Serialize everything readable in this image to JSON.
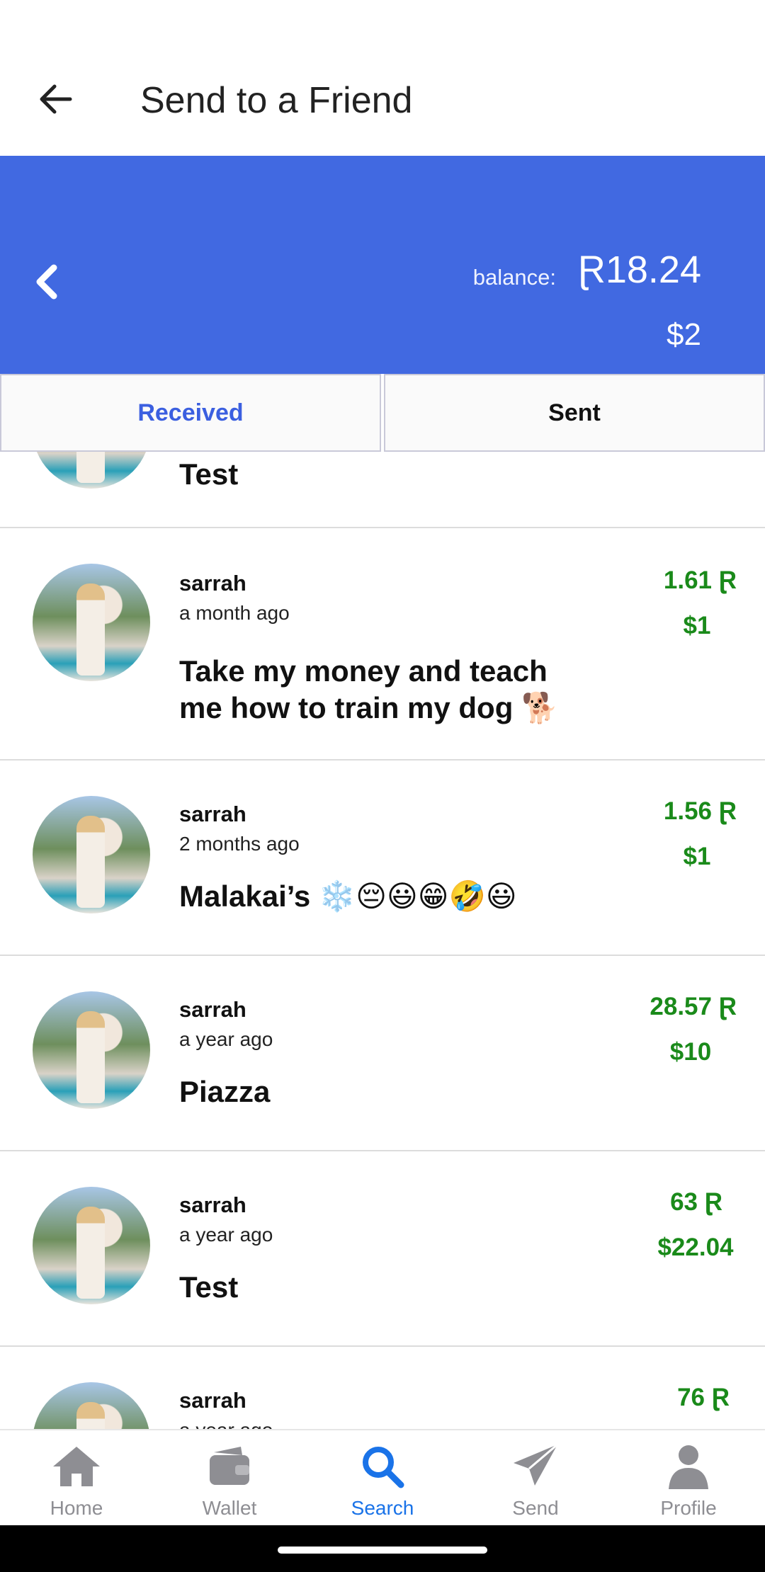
{
  "appbar": {
    "title": "Send to a Friend",
    "back_icon": "arrow-left-icon"
  },
  "balance": {
    "label": "balance:",
    "value": "Ɽ18.24",
    "usd": "$2"
  },
  "tabs": [
    {
      "label": "Received"
    },
    {
      "label": "Sent"
    }
  ],
  "transactions": [
    {
      "sender": "",
      "time": "",
      "message": "Test",
      "amount": "",
      "usd": ""
    },
    {
      "sender": "sarrah",
      "time": "a month ago",
      "message": "Take my money and teach me how to train my dog 🐕",
      "amount": "1.61 Ɽ",
      "usd": "$1"
    },
    {
      "sender": "sarrah",
      "time": "2 months ago",
      "message": "Malakai’s ❄️😔😃😁🤣😃",
      "amount": "1.56 Ɽ",
      "usd": "$1"
    },
    {
      "sender": "sarrah",
      "time": "a year ago",
      "message": "Piazza",
      "amount": "28.57 Ɽ",
      "usd": "$10"
    },
    {
      "sender": "sarrah",
      "time": "a year ago",
      "message": "Test",
      "amount": "63 Ɽ",
      "usd": "$22.04"
    },
    {
      "sender": "sarrah",
      "time": "a year ago",
      "message": "",
      "amount": "76 Ɽ",
      "usd": ""
    }
  ],
  "nav": [
    {
      "label": "Home",
      "icon": "home-icon"
    },
    {
      "label": "Wallet",
      "icon": "wallet-icon"
    },
    {
      "label": "Search",
      "icon": "search-icon"
    },
    {
      "label": "Send",
      "icon": "send-icon"
    },
    {
      "label": "Profile",
      "icon": "profile-icon"
    }
  ],
  "colors": {
    "header_blue": "#4169e1",
    "amount_green": "#1a8a1a",
    "active_nav": "#1a73e8"
  }
}
